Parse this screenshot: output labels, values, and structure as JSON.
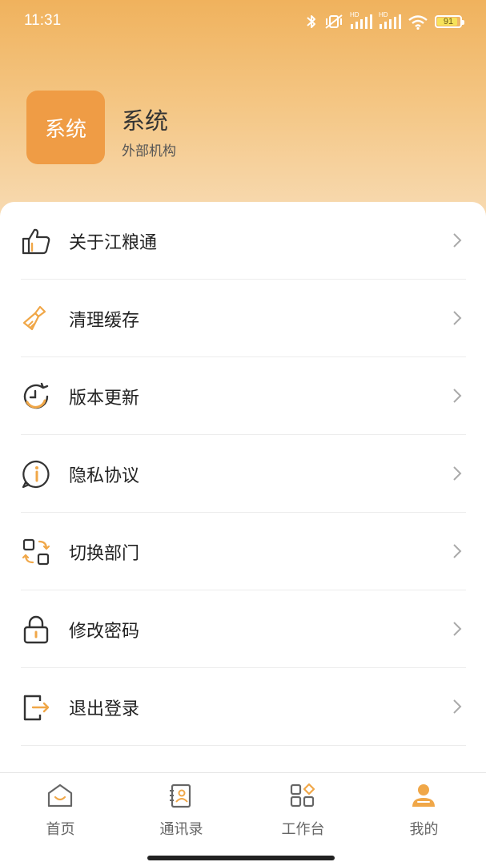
{
  "status_bar": {
    "time": "11:31",
    "battery_level": 91,
    "battery_text": "91",
    "icons": [
      "bluetooth-icon",
      "mute-vibrate-icon",
      "signal-hd-icon",
      "signal-hd-icon",
      "wifi-icon",
      "battery-icon"
    ],
    "hd_label": "HD"
  },
  "profile": {
    "avatar_text": "系统",
    "name": "系统",
    "org": "外部机构",
    "avatar_color": "#ef9c45"
  },
  "menu": {
    "items": [
      {
        "label": "关于江粮通",
        "icon": "thumbs-up-icon"
      },
      {
        "label": "清理缓存",
        "icon": "broom-icon"
      },
      {
        "label": "版本更新",
        "icon": "refresh-clock-icon"
      },
      {
        "label": "隐私协议",
        "icon": "info-bubble-icon"
      },
      {
        "label": "切换部门",
        "icon": "switch-grid-icon"
      },
      {
        "label": "修改密码",
        "icon": "lock-icon"
      },
      {
        "label": "退出登录",
        "icon": "logout-icon"
      }
    ]
  },
  "tabbar": {
    "items": [
      {
        "label": "首页",
        "icon": "home-icon"
      },
      {
        "label": "通讯录",
        "icon": "contacts-icon"
      },
      {
        "label": "工作台",
        "icon": "workbench-icon"
      },
      {
        "label": "我的",
        "icon": "person-icon",
        "active": true
      }
    ]
  },
  "colors": {
    "accent": "#f0a748",
    "accent_light": "#f8ddb8",
    "text_primary": "#222222",
    "divider": "#ececec"
  }
}
